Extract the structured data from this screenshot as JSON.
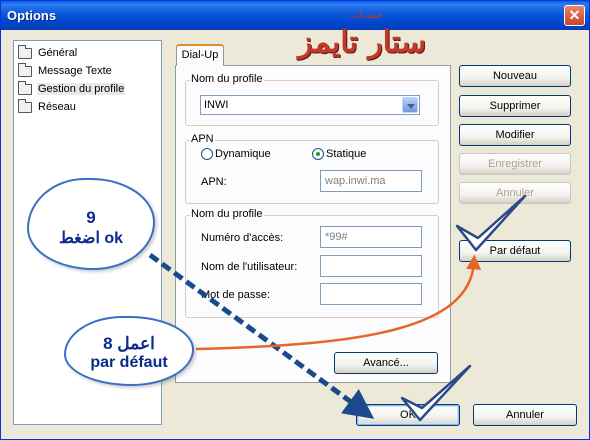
{
  "window": {
    "title": "Options",
    "close_symbol": "✕"
  },
  "logo": {
    "text": "ستار تايمز",
    "small": "منتديات"
  },
  "tree": {
    "items": [
      {
        "label": "Général",
        "selected": false
      },
      {
        "label": "Message Texte",
        "selected": false
      },
      {
        "label": "Gestion du profile",
        "selected": true
      },
      {
        "label": "Réseau",
        "selected": false
      }
    ]
  },
  "tab": {
    "label": "Dial-Up"
  },
  "profile_group": {
    "label": "Nom du profile",
    "selected_profile": "INWI"
  },
  "apn_group": {
    "label": "APN",
    "radio_dynamic": "Dynamique",
    "radio_static": "Statique",
    "selected": "Statique",
    "apn_label": "APN:",
    "apn_value": "wap.inwi.ma"
  },
  "auth_group": {
    "label": "Nom du profile",
    "access_label": "Numéro d'accès:",
    "access_value": "*99#",
    "user_label": "Nom de l'utilisateur:",
    "user_value": "",
    "pass_label": "Mot de passe:",
    "pass_value": ""
  },
  "buttons": {
    "nouveau": "Nouveau",
    "supprimer": "Supprimer",
    "modifier": "Modifier",
    "enregistrer": "Enregistrer",
    "annuler_side": "Annuler",
    "par_defaut": "Par défaut",
    "avance": "Avancé...",
    "ok": "OK",
    "annuler": "Annuler"
  },
  "annotations": {
    "bubble1_line1": "9",
    "bubble1_line2": "اضغط ok",
    "bubble2_line1": "8 اعمل",
    "bubble2_line2": "par défaut",
    "arrow_blue_color": "#1a4a8c",
    "arrow_orange_color": "#e8652a",
    "check_color": "#2c4b86"
  }
}
